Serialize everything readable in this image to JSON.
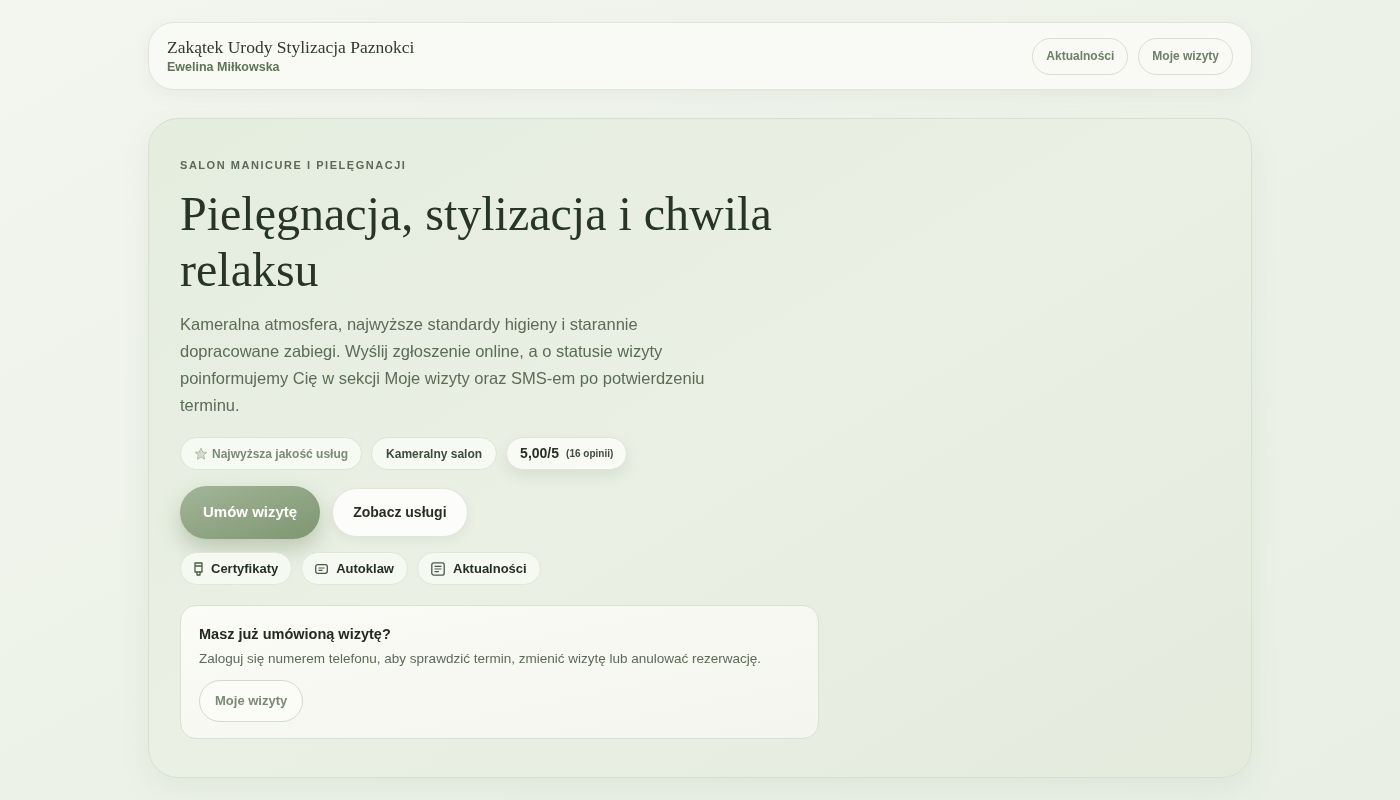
{
  "header": {
    "title": "Zakątek Urody Stylizacja Paznokci",
    "subtitle": "Ewelina Miłkowska",
    "nav": [
      {
        "label": "Aktualności"
      },
      {
        "label": "Moje wizyty"
      }
    ]
  },
  "hero": {
    "eyebrow": "SALON MANICURE I PIELĘGNACJI",
    "heading": "Pielęgnacja, stylizacja i chwila relaksu",
    "description": "Kameralna atmosfera, najwyższe standardy higieny i starannie dopracowane zabiegi. Wyślij zgłoszenie online, a o statusie wizyty poinformujemy Cię w sekcji Moje wizyty oraz SMS-em po potwierdzeniu terminu.",
    "badges": [
      {
        "kind": "feature",
        "label": "Najwyższa jakość usług"
      },
      {
        "kind": "plain",
        "label": "Kameralny salon"
      },
      {
        "kind": "rating",
        "label": "5,00/5",
        "note": "(16 opinii)"
      }
    ],
    "actions": [
      {
        "kind": "primary",
        "label": "Umów wizytę"
      },
      {
        "kind": "secondary",
        "label": "Zobacz usługi"
      }
    ],
    "links": [
      {
        "label": "Certyfikaty"
      },
      {
        "label": "Autoklaw"
      },
      {
        "label": "Aktualności"
      }
    ],
    "login_card": {
      "title": "Masz już umówioną wizytę?",
      "text": "Zaloguj się numerem telefonu, aby sprawdzić termin, zmienić wizytę lub anulować rezerwację.",
      "button": "Moje wizyty"
    }
  }
}
